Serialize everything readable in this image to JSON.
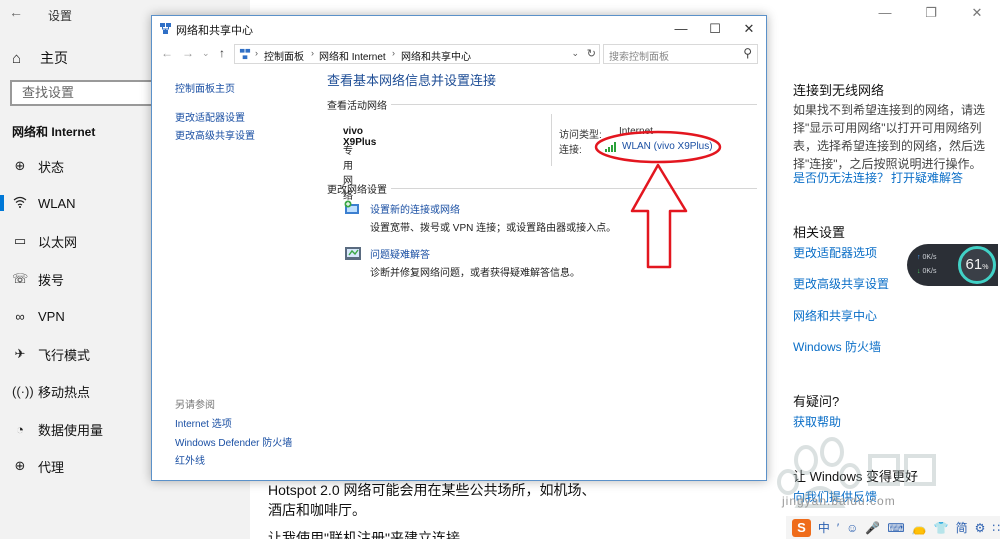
{
  "settings": {
    "title": "设置",
    "home_label": "主页",
    "search_placeholder": "查找设置",
    "section_title": "网络和 Internet",
    "nav": [
      {
        "label": "状态",
        "icon": "globe-icon"
      },
      {
        "label": "WLAN",
        "icon": "wifi-icon"
      },
      {
        "label": "以太网",
        "icon": "ethernet-icon"
      },
      {
        "label": "拨号",
        "icon": "dialup-icon"
      },
      {
        "label": "VPN",
        "icon": "vpn-icon"
      },
      {
        "label": "飞行模式",
        "icon": "airplane-icon"
      },
      {
        "label": "移动热点",
        "icon": "hotspot-icon"
      },
      {
        "label": "数据使用量",
        "icon": "data-usage-icon"
      },
      {
        "label": "代理",
        "icon": "proxy-icon"
      }
    ],
    "active_index": 1
  },
  "right_panel": {
    "wireless_heading": "连接到无线网络",
    "wireless_text": "如果找不到希望连接到的网络，请选择\"显示可用网络\"以打开可用网络列表，选择希望连接到的网络，然后选择\"连接\"，之后按照说明进行操作。",
    "still_cannot": "是否仍无法连接？",
    "troubleshoot": "打开疑难解答",
    "related_heading": "相关设置",
    "related_links": [
      "更改适配器选项",
      "更改高级共享设置",
      "网络和共享中心",
      "Windows 防火墙"
    ],
    "question_heading": "有疑问?",
    "get_help": "获取帮助",
    "improve_heading": "让 Windows 变得更好",
    "feedback": "向我们提供反馈"
  },
  "content": {
    "hotspot_text": "Hotspot 2.0 网络可能会用在某些公共场所，如机场、酒店和咖啡厅。",
    "bottom_cut": "让我使用\"联机注册\"来建立连接"
  },
  "speed_widget": {
    "up": "0K/s",
    "down": "0K/s",
    "percent": "61",
    "percent_unit": "%"
  },
  "watermark": {
    "text": "jingyan.baidu.com"
  },
  "ime": {
    "logo": "S",
    "items": [
      "中",
      "′",
      "☺",
      "🎤",
      "⌨",
      "👝",
      "👕",
      "简",
      "⚙",
      "∷"
    ]
  },
  "control_panel": {
    "title": "网络和共享中心",
    "address": {
      "crumbs": [
        "控制面板",
        "网络和 Internet",
        "网络和共享中心"
      ],
      "search_placeholder": "搜索控制面板"
    },
    "left_links": [
      "控制面板主页",
      "更改适配器设置",
      "更改高级共享设置"
    ],
    "see_also_heading": "另请参阅",
    "see_also_links": [
      "Internet 选项",
      "Windows Defender 防火墙",
      "红外线"
    ],
    "main_title": "查看基本网络信息并设置连接",
    "active_networks_heading": "查看活动网络",
    "network": {
      "name": "vivo X9Plus",
      "type": "专用网络",
      "access_type_label": "访问类型:",
      "access_type_value": "Internet",
      "connection_label": "连接:",
      "connection_value": "WLAN (vivo X9Plus)"
    },
    "change_settings_heading": "更改网络设置",
    "tasks": [
      {
        "link": "设置新的连接或网络",
        "desc": "设置宽带、拨号或 VPN 连接；或设置路由器或接入点。"
      },
      {
        "link": "问题疑难解答",
        "desc": "诊断并修复网络问题，或者获得疑难解答信息。"
      }
    ]
  },
  "colors": {
    "accent": "#0078d7",
    "link": "#1a4fa3",
    "annotation": "#e3161f"
  }
}
